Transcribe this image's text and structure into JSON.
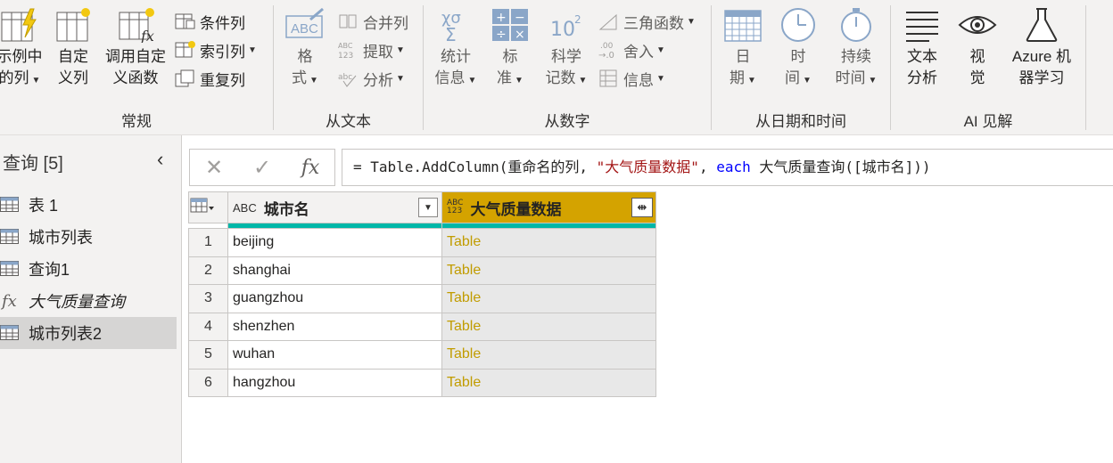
{
  "ribbon": {
    "groups": {
      "general": {
        "label": "常规",
        "column_from_examples": {
          "line1": "示例中",
          "line2": "的列"
        },
        "custom_column": {
          "line1": "自定",
          "line2": "义列"
        },
        "invoke_custom_function": {
          "line1": "调用自定",
          "line2": "义函数"
        },
        "conditional_column": "条件列",
        "index_column": "索引列",
        "duplicate_column": "重复列"
      },
      "from_text": {
        "label": "从文本",
        "format": {
          "line1": "格",
          "line2": "式"
        },
        "merge_columns": "合并列",
        "extract": "提取",
        "parse": "分析"
      },
      "from_number": {
        "label": "从数字",
        "statistics": {
          "line1": "统计",
          "line2": "信息"
        },
        "standard": {
          "line1": "标",
          "line2": "准"
        },
        "scientific": {
          "line1": "科学",
          "line2": "记数"
        },
        "trigonometry": "三角函数",
        "rounding": "舍入",
        "information": "信息"
      },
      "from_datetime": {
        "label": "从日期和时间",
        "date": {
          "line1": "日",
          "line2": "期"
        },
        "time": {
          "line1": "时",
          "line2": "间"
        },
        "duration": {
          "line1": "持续",
          "line2": "时间"
        }
      },
      "ai_insights": {
        "label": "AI 见解",
        "text_analytics": {
          "line1": "文本",
          "line2": "分析"
        },
        "vision": {
          "line1": "视",
          "line2": "觉"
        },
        "azure_ml": {
          "line1": "Azure 机",
          "line2": "器学习"
        }
      }
    }
  },
  "queries_pane": {
    "title": "查询 [5]",
    "items": [
      {
        "label": "表 1",
        "type": "table",
        "selected": false
      },
      {
        "label": "城市列表",
        "type": "table",
        "selected": false
      },
      {
        "label": "查询1",
        "type": "table",
        "selected": false
      },
      {
        "label": "大气质量查询",
        "type": "function",
        "selected": false
      },
      {
        "label": "城市列表2",
        "type": "table",
        "selected": true
      }
    ]
  },
  "formula_bar": {
    "prefix": "= Table.AddColumn(重命名的列, ",
    "string_literal": "\"大气质量数据\"",
    "sep": ", ",
    "keyword": "each",
    "suffix": " 大气质量查询([城市名]))"
  },
  "grid": {
    "columns": [
      {
        "name": "城市名",
        "type_label": "ABC"
      },
      {
        "name": "大气质量数据",
        "type_label_top": "ABC",
        "type_label_bottom": "123"
      }
    ],
    "rows": [
      {
        "num": "1",
        "city": "beijing",
        "data": "Table"
      },
      {
        "num": "2",
        "city": "shanghai",
        "data": "Table"
      },
      {
        "num": "3",
        "city": "guangzhou",
        "data": "Table"
      },
      {
        "num": "4",
        "city": "shenzhen",
        "data": "Table"
      },
      {
        "num": "5",
        "city": "wuhan",
        "data": "Table"
      },
      {
        "num": "6",
        "city": "hangzhou",
        "data": "Table"
      }
    ]
  },
  "colors": {
    "selected_header": "#d4a300",
    "quality_bar": "#00b7a8",
    "table_link": "#c19c00"
  }
}
